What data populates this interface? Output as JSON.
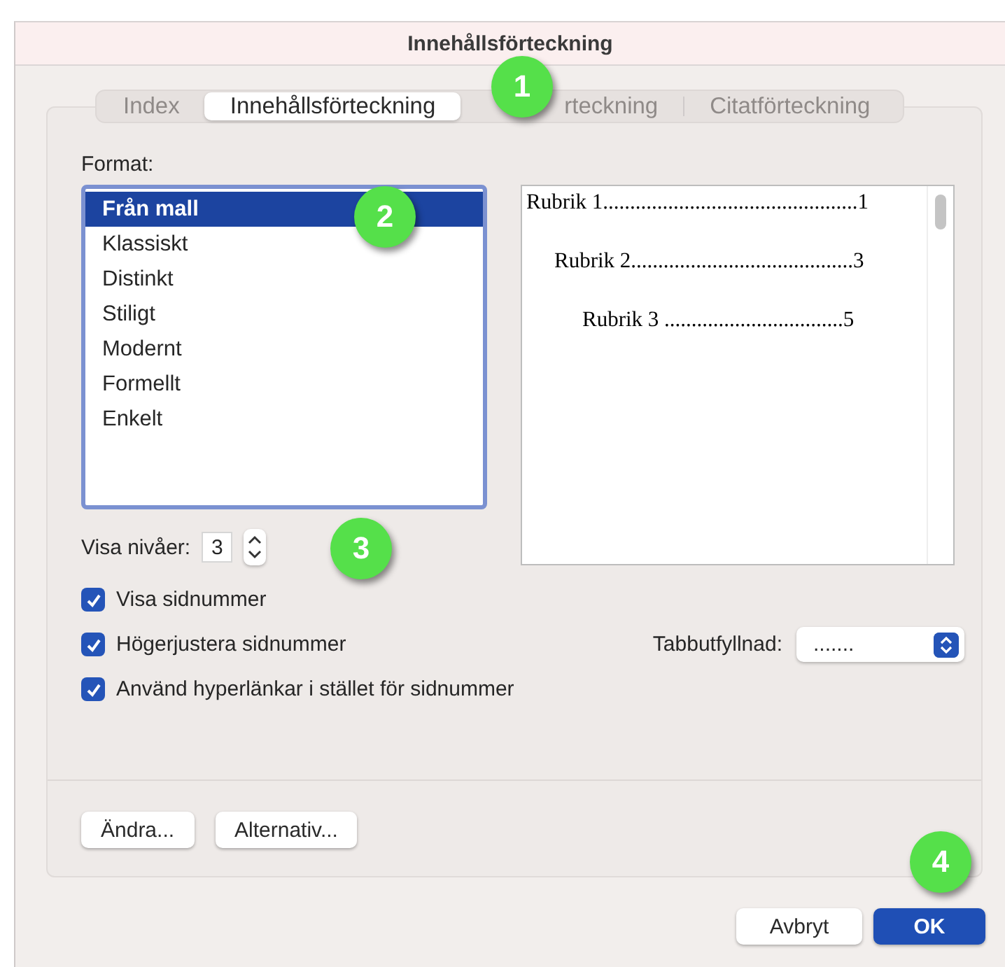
{
  "window": {
    "title": "Innehållsförteckning"
  },
  "tabs": [
    {
      "label": "Index",
      "selected": false
    },
    {
      "label": "Innehållsförteckning",
      "selected": true
    },
    {
      "label": "rteckning",
      "selected": false
    },
    {
      "label": "Citatförteckning",
      "selected": false
    }
  ],
  "format": {
    "label": "Format:",
    "items": [
      {
        "label": "Från mall",
        "selected": true
      },
      {
        "label": "Klassiskt",
        "selected": false
      },
      {
        "label": "Distinkt",
        "selected": false
      },
      {
        "label": "Stiligt",
        "selected": false
      },
      {
        "label": "Modernt",
        "selected": false
      },
      {
        "label": "Formellt",
        "selected": false
      },
      {
        "label": "Enkelt",
        "selected": false
      }
    ]
  },
  "preview": {
    "entries": [
      {
        "text": "Rubrik 1...............................................1",
        "children": [
          {
            "text": "Rubrik 2.........................................3",
            "children": [
              {
                "text": "Rubrik 3 .................................5"
              }
            ]
          }
        ]
      }
    ]
  },
  "levels": {
    "label": "Visa nivåer:",
    "value": "3"
  },
  "options": [
    {
      "label": "Visa sidnummer",
      "checked": true
    },
    {
      "label": "Högerjustera sidnummer",
      "checked": true
    },
    {
      "label": "Använd hyperlänkar i stället för sidnummer",
      "checked": true
    }
  ],
  "tab_leader": {
    "label": "Tabbutfyllnad:",
    "value": "......."
  },
  "panel_buttons": [
    "Ändra...",
    "Alternativ..."
  ],
  "dialog_buttons": [
    {
      "label": "Avbryt",
      "kind": "normal"
    },
    {
      "label": "OK",
      "kind": "default"
    }
  ],
  "callouts": [
    "1",
    "2",
    "3",
    "4"
  ]
}
